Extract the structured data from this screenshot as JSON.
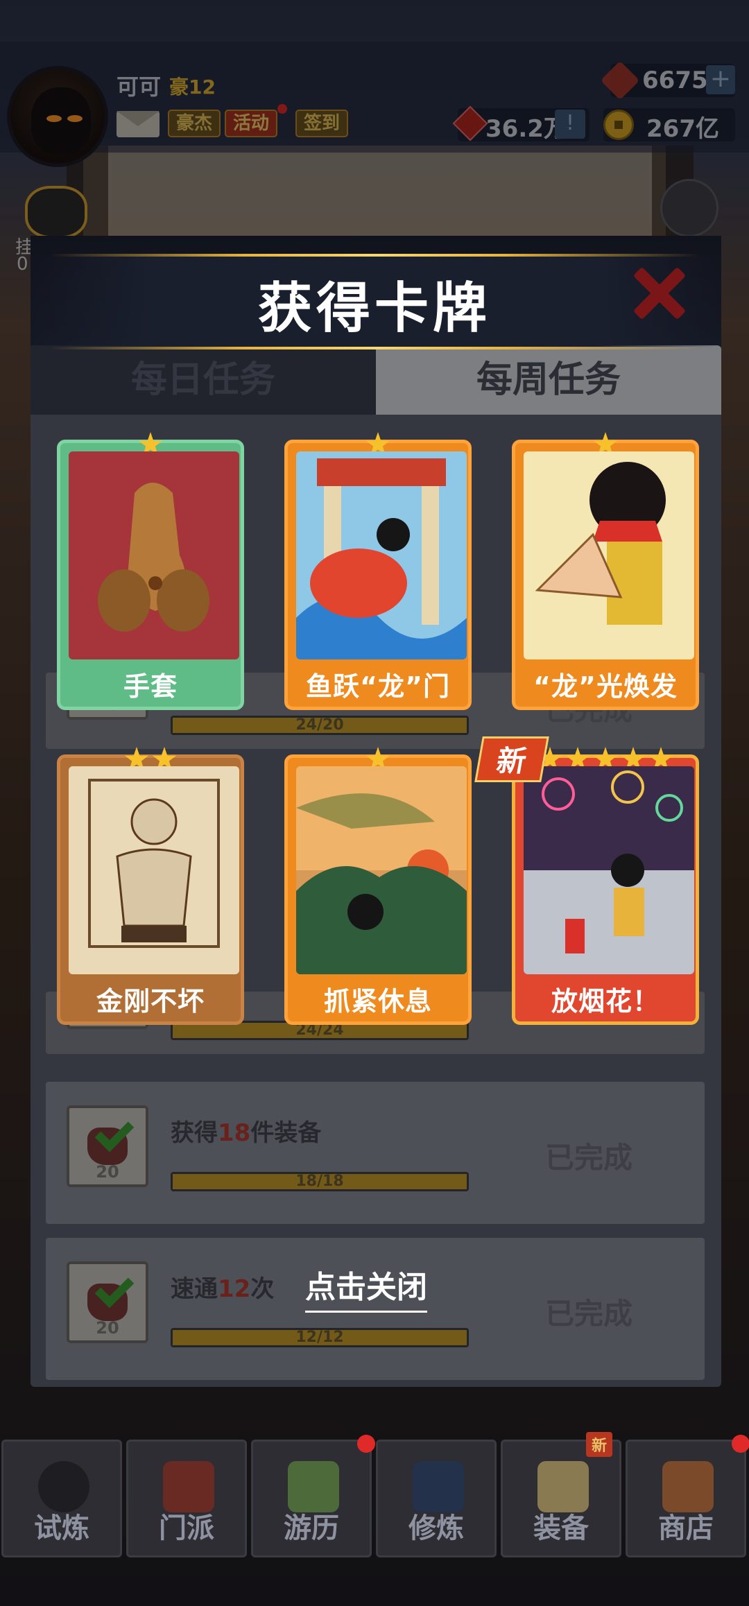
{
  "player": {
    "name": "可可",
    "rank": "豪12",
    "buttons": {
      "haojie": "豪杰",
      "huodong": "活动",
      "qiandao": "签到"
    }
  },
  "resources": {
    "gems": "6675",
    "power": "36.2万",
    "coins": "267亿",
    "plus": "+",
    "info": "!"
  },
  "side": {
    "chest_text": "挂",
    "chest_num": "0"
  },
  "panel": {
    "tabs": [
      "每日任务",
      "每周任务"
    ],
    "tasks": [
      {
        "desc_prefix": "获得",
        "desc_highlight": "18",
        "desc_suffix": "件装备",
        "reward": "20",
        "progress_text": "18/18",
        "progress": 1.0,
        "status": "已完成"
      },
      {
        "desc_prefix": "速通",
        "desc_highlight": "12",
        "desc_suffix": "次",
        "reward": "20",
        "progress_text": "12/12",
        "progress": 1.0,
        "status": "已完成"
      }
    ],
    "partial_rows": [
      {
        "reward": "20",
        "progress_text": "24/20",
        "status": "已完成"
      },
      {
        "reward": "20",
        "progress_text": "24/24"
      }
    ]
  },
  "popup": {
    "title": "获得卡牌",
    "close_hint": "点击关闭",
    "new_badge": "新",
    "cards": [
      {
        "label": "手套",
        "stars": 1,
        "rarity": "green"
      },
      {
        "label": "鱼跃“龙”门",
        "stars": 1,
        "rarity": "orange"
      },
      {
        "label": "“龙”光焕发",
        "stars": 1,
        "rarity": "orange"
      },
      {
        "label": "金刚不坏",
        "stars": 2,
        "rarity": "brown"
      },
      {
        "label": "抓紧休息",
        "stars": 1,
        "rarity": "orange"
      },
      {
        "label": "放烟花！",
        "stars": 5,
        "rarity": "red"
      }
    ]
  },
  "nav": [
    {
      "label": "试炼",
      "icon": "ninja-icon"
    },
    {
      "label": "门派",
      "icon": "temple-icon"
    },
    {
      "label": "游历",
      "icon": "mountain-icon"
    },
    {
      "label": "修炼",
      "icon": "book-icon"
    },
    {
      "label": "装备",
      "icon": "sword-icon",
      "badge": "新"
    },
    {
      "label": "商店",
      "icon": "shop-icon"
    }
  ],
  "colors": {
    "accent_gold": "#e7b441",
    "card_green": "#5fbc86",
    "card_orange": "#ef8a1e",
    "card_brown": "#b26f35",
    "card_red": "#e1472f"
  }
}
